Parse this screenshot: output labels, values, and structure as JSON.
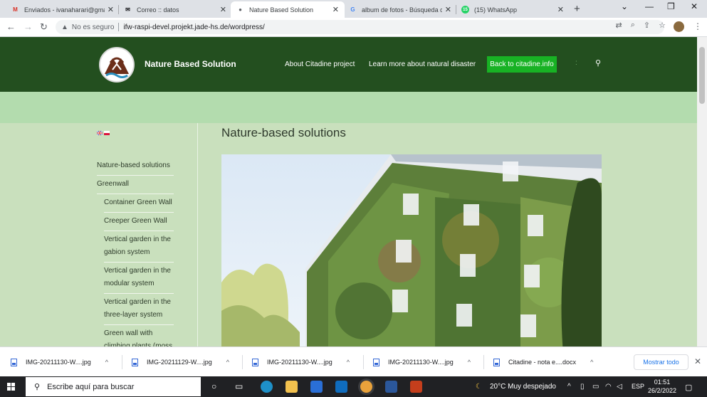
{
  "browser": {
    "tabs": [
      {
        "title": "Enviados - ivanaharari@gma",
        "favicon": "gmail-icon",
        "active": false
      },
      {
        "title": "Correo :: datos",
        "favicon": "mail-icon",
        "active": false
      },
      {
        "title": "Nature Based Solution",
        "favicon": "site-icon",
        "active": true
      },
      {
        "title": "album de fotos - Búsqueda d",
        "favicon": "google-icon",
        "active": false
      },
      {
        "title": "(15) WhatsApp",
        "favicon": "whatsapp-icon",
        "active": false
      }
    ],
    "whatsapp_badge": "15",
    "address": {
      "security_label": "No es seguro",
      "url": "ifw-raspi-devel.projekt.jade-hs.de/wordpress/"
    }
  },
  "site": {
    "name": "Nature Based Solution",
    "nav": {
      "about": "About Citadine project",
      "learn": "Learn more about natural disaster",
      "back": "Back to citadine.info"
    },
    "page_title": "Nature-based solutions",
    "sidebar": [
      {
        "label": "Nature-based solutions",
        "level": 0
      },
      {
        "label": "Greenwall",
        "level": 0
      },
      {
        "label": "Container Green Wall",
        "level": 1
      },
      {
        "label": "Creeper Green Wall",
        "level": 1
      },
      {
        "label": "Vertical garden in the",
        "label2": "gabion system",
        "level": 1
      },
      {
        "label": "Vertical garden in the",
        "label2": "modular system",
        "level": 1
      },
      {
        "label": "Vertical garden in the",
        "label2": "three-layer system",
        "level": 1
      },
      {
        "label": "Green wall with",
        "label2": "climbing plants (moss",
        "level": 1
      }
    ],
    "colors": {
      "header": "#234f1f",
      "band": "#b3dcae",
      "body": "#c9e0bd",
      "button": "#18b224"
    }
  },
  "downloads": {
    "items": [
      {
        "name": "IMG-20211130-W....jpg",
        "type": "image"
      },
      {
        "name": "IMG-20211129-W....jpg",
        "type": "image"
      },
      {
        "name": "IMG-20211130-W....jpg",
        "type": "image"
      },
      {
        "name": "IMG-20211130-W....jpg",
        "type": "image"
      },
      {
        "name": "Citadine - nota e....docx",
        "type": "word"
      }
    ],
    "show_all": "Mostrar todo"
  },
  "taskbar": {
    "search_placeholder": "Escribe aquí para buscar",
    "weather": "20°C  Muy despejado",
    "language": "ESP",
    "time": "01:51",
    "date": "26/2/2022"
  }
}
